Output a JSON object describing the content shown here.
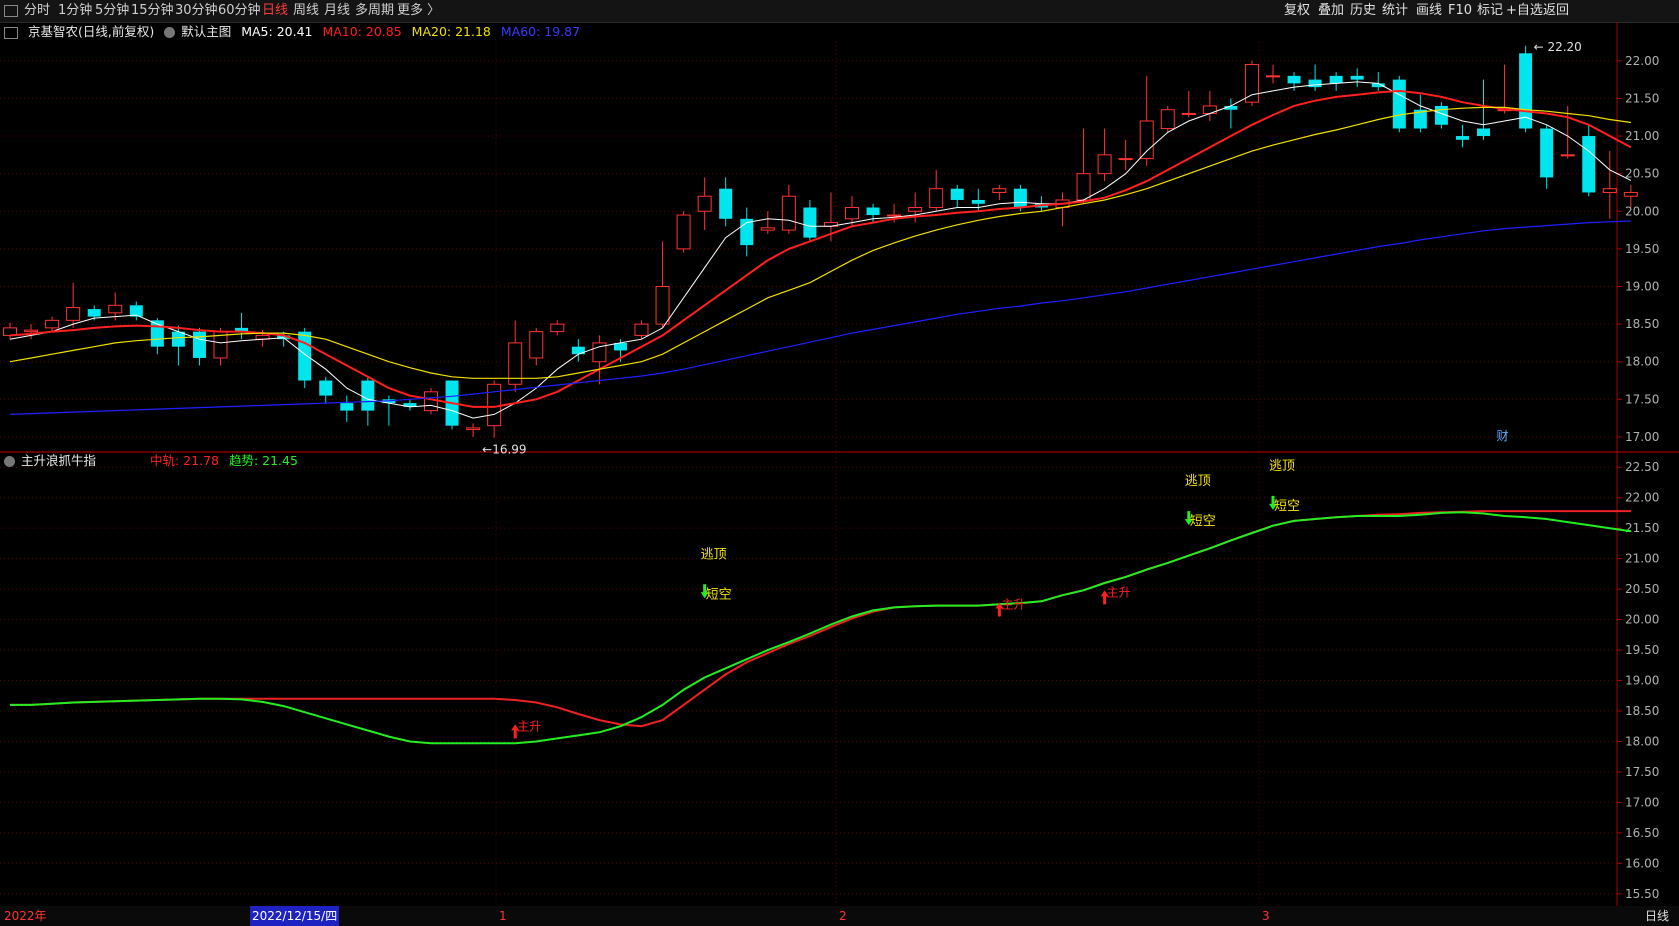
{
  "toolbar": {
    "periods": [
      "分时",
      "1分钟",
      "5分钟",
      "15分钟",
      "30分钟",
      "60分钟",
      "日线",
      "周线",
      "月线",
      "多周期",
      "更多 〉"
    ],
    "active_period": "日线",
    "right_buttons": [
      "复权",
      "叠加",
      "历史",
      "统计",
      "画线",
      "F10",
      "标记",
      "+自选",
      "返回"
    ]
  },
  "stock_info": {
    "name": "京基智农",
    "period_desc": "(日线,前复权)",
    "main_chart_label": "默认主图",
    "ma5": "MA5: 20.41",
    "ma10": "MA10: 20.85",
    "ma20": "MA20: 21.18",
    "ma60": "MA60: 19.87"
  },
  "indicator_info": {
    "name": "主升浪抓牛指",
    "mid": "中轨: 21.78",
    "trend": "趋势: 21.45"
  },
  "colors": {
    "up": "#ff3333",
    "down": "#00e5ee",
    "ma5": "#ffffff",
    "ma10": "#ff2020",
    "ma20": "#f0e000",
    "ma60": "#2020ff",
    "trend": "#22ee22",
    "mid": "#ee2222",
    "grid": "#5a0000",
    "axis_text": "#b0b0b0",
    "label_yellow": "#f5e400"
  },
  "bottom": {
    "year": "2022年",
    "date_cursor": "2022/12/15/四",
    "months": [
      "1",
      "2",
      "3"
    ],
    "period_right": "日线"
  },
  "chart_data": [
    {
      "type": "candlestick",
      "title": "京基智农",
      "ylim": [
        16.8,
        22.25
      ],
      "yticks": [
        "17.00",
        "17.50",
        "18.00",
        "18.50",
        "19.00",
        "19.50",
        "20.00",
        "20.50",
        "21.00",
        "21.50",
        "22.00"
      ],
      "high_label": "22.20",
      "low_label": "16.99",
      "marker": "财",
      "candles": [
        [
          18.35,
          18.45,
          18.3,
          18.52
        ],
        [
          18.4,
          18.42,
          18.3,
          18.5
        ],
        [
          18.45,
          18.55,
          18.4,
          18.6
        ],
        [
          18.55,
          18.72,
          18.45,
          19.05
        ],
        [
          18.7,
          18.6,
          18.55,
          18.75
        ],
        [
          18.65,
          18.75,
          18.55,
          18.92
        ],
        [
          18.75,
          18.6,
          18.55,
          18.8
        ],
        [
          18.55,
          18.2,
          18.1,
          18.58
        ],
        [
          18.4,
          18.2,
          17.95,
          18.48
        ],
        [
          18.4,
          18.05,
          17.95,
          18.45
        ],
        [
          18.05,
          18.4,
          17.95,
          18.45
        ],
        [
          18.45,
          18.4,
          18.3,
          18.65
        ],
        [
          18.3,
          18.35,
          18.2,
          18.42
        ],
        [
          18.35,
          18.3,
          18.2,
          18.4
        ],
        [
          18.4,
          17.75,
          17.65,
          18.45
        ],
        [
          17.75,
          17.55,
          17.45,
          17.8
        ],
        [
          17.45,
          17.35,
          17.2,
          17.55
        ],
        [
          17.75,
          17.35,
          17.15,
          17.8
        ],
        [
          17.5,
          17.45,
          17.15,
          17.55
        ],
        [
          17.45,
          17.4,
          17.35,
          17.5
        ],
        [
          17.35,
          17.6,
          17.3,
          17.65
        ],
        [
          17.75,
          17.15,
          17.1,
          17.75
        ],
        [
          17.1,
          17.12,
          17.0,
          17.18
        ],
        [
          17.15,
          17.7,
          16.99,
          17.75
        ],
        [
          17.7,
          18.25,
          17.6,
          18.55
        ],
        [
          18.05,
          18.4,
          17.95,
          18.45
        ],
        [
          18.4,
          18.5,
          18.35,
          18.55
        ],
        [
          18.2,
          18.1,
          18.0,
          18.3
        ],
        [
          18.0,
          18.25,
          17.7,
          18.35
        ],
        [
          18.25,
          18.15,
          18.0,
          18.3
        ],
        [
          18.35,
          18.5,
          18.3,
          18.55
        ],
        [
          18.5,
          19.0,
          18.45,
          19.6
        ],
        [
          19.5,
          19.95,
          19.45,
          20.0
        ],
        [
          20.0,
          20.2,
          19.75,
          20.45
        ],
        [
          20.3,
          19.9,
          19.8,
          20.45
        ],
        [
          19.9,
          19.55,
          19.4,
          20.05
        ],
        [
          19.75,
          19.78,
          19.7,
          20.0
        ],
        [
          19.75,
          20.2,
          19.7,
          20.35
        ],
        [
          20.05,
          19.65,
          19.6,
          20.15
        ],
        [
          19.8,
          19.85,
          19.6,
          20.25
        ],
        [
          19.9,
          20.05,
          19.8,
          20.2
        ],
        [
          20.05,
          19.95,
          19.85,
          20.1
        ],
        [
          19.95,
          19.95,
          19.85,
          20.1
        ],
        [
          20.0,
          20.05,
          19.85,
          20.25
        ],
        [
          20.05,
          20.3,
          20.0,
          20.55
        ],
        [
          20.3,
          20.15,
          20.05,
          20.35
        ],
        [
          20.15,
          20.1,
          20.0,
          20.3
        ],
        [
          20.25,
          20.3,
          20.15,
          20.35
        ],
        [
          20.3,
          20.05,
          20.0,
          20.35
        ],
        [
          20.1,
          20.05,
          20.0,
          20.2
        ],
        [
          20.05,
          20.15,
          19.8,
          20.25
        ],
        [
          20.15,
          20.5,
          20.1,
          21.1
        ],
        [
          20.5,
          20.75,
          20.4,
          21.1
        ],
        [
          20.7,
          20.7,
          20.55,
          20.95
        ],
        [
          20.7,
          21.2,
          20.6,
          21.8
        ],
        [
          21.1,
          21.35,
          21.05,
          21.4
        ],
        [
          21.3,
          21.3,
          21.25,
          21.6
        ],
        [
          21.3,
          21.4,
          21.2,
          21.6
        ],
        [
          21.4,
          21.35,
          21.1,
          21.5
        ],
        [
          21.45,
          21.95,
          21.4,
          22.0
        ],
        [
          21.8,
          21.8,
          21.7,
          21.95
        ],
        [
          21.8,
          21.7,
          21.6,
          21.85
        ],
        [
          21.75,
          21.65,
          21.6,
          21.95
        ],
        [
          21.8,
          21.7,
          21.6,
          21.85
        ],
        [
          21.8,
          21.75,
          21.65,
          21.9
        ],
        [
          21.7,
          21.65,
          21.6,
          21.85
        ],
        [
          21.75,
          21.1,
          21.05,
          21.8
        ],
        [
          21.35,
          21.1,
          21.05,
          21.55
        ],
        [
          21.4,
          21.15,
          21.1,
          21.45
        ],
        [
          21.0,
          20.95,
          20.85,
          21.15
        ],
        [
          21.1,
          21.0,
          20.95,
          21.75
        ],
        [
          21.35,
          21.35,
          21.3,
          21.95
        ],
        [
          22.1,
          21.1,
          21.05,
          22.2
        ],
        [
          21.1,
          20.45,
          20.3,
          21.15
        ],
        [
          20.75,
          20.75,
          20.7,
          21.4
        ],
        [
          21.0,
          20.25,
          20.2,
          21.15
        ],
        [
          20.25,
          20.3,
          19.9,
          20.8
        ],
        [
          20.2,
          20.25,
          20.05,
          20.35
        ]
      ],
      "series": [
        {
          "name": "MA5",
          "values": [
            18.3,
            18.35,
            18.4,
            18.5,
            18.58,
            18.6,
            18.62,
            18.5,
            18.4,
            18.3,
            18.25,
            18.28,
            18.3,
            18.32,
            18.1,
            17.9,
            17.65,
            17.5,
            17.45,
            17.4,
            17.42,
            17.35,
            17.25,
            17.3,
            17.45,
            17.65,
            17.9,
            18.1,
            18.2,
            18.25,
            18.3,
            18.45,
            18.85,
            19.25,
            19.65,
            19.85,
            19.9,
            19.88,
            19.8,
            19.8,
            19.85,
            19.9,
            19.92,
            19.95,
            20.0,
            20.05,
            20.05,
            20.1,
            20.12,
            20.1,
            20.1,
            20.15,
            20.3,
            20.5,
            20.8,
            21.05,
            21.2,
            21.3,
            21.4,
            21.55,
            21.6,
            21.65,
            21.68,
            21.7,
            21.72,
            21.7,
            21.55,
            21.4,
            21.3,
            21.2,
            21.15,
            21.2,
            21.25,
            21.15,
            21.0,
            20.8,
            20.55,
            20.41
          ]
        },
        {
          "name": "MA10",
          "values": [
            18.35,
            18.37,
            18.4,
            18.42,
            18.45,
            18.47,
            18.48,
            18.47,
            18.45,
            18.42,
            18.4,
            18.4,
            18.38,
            18.35,
            18.25,
            18.1,
            17.95,
            17.8,
            17.65,
            17.55,
            17.5,
            17.45,
            17.4,
            17.4,
            17.45,
            17.5,
            17.6,
            17.75,
            17.9,
            18.05,
            18.2,
            18.35,
            18.55,
            18.75,
            18.95,
            19.15,
            19.35,
            19.5,
            19.6,
            19.7,
            19.8,
            19.85,
            19.9,
            19.93,
            19.95,
            19.98,
            20.0,
            20.03,
            20.05,
            20.08,
            20.1,
            20.13,
            20.18,
            20.28,
            20.4,
            20.55,
            20.7,
            20.85,
            21.0,
            21.15,
            21.28,
            21.4,
            21.47,
            21.52,
            21.55,
            21.58,
            21.6,
            21.57,
            21.52,
            21.45,
            21.4,
            21.36,
            21.33,
            21.3,
            21.25,
            21.15,
            21.0,
            20.85
          ]
        },
        {
          "name": "MA20",
          "values": [
            18.0,
            18.05,
            18.1,
            18.15,
            18.2,
            18.25,
            18.28,
            18.3,
            18.32,
            18.33,
            18.35,
            18.37,
            18.38,
            18.38,
            18.35,
            18.3,
            18.2,
            18.1,
            18.0,
            17.92,
            17.85,
            17.8,
            17.78,
            17.78,
            17.78,
            17.78,
            17.8,
            17.85,
            17.9,
            17.95,
            18.0,
            18.1,
            18.25,
            18.4,
            18.55,
            18.7,
            18.85,
            18.95,
            19.05,
            19.2,
            19.35,
            19.48,
            19.58,
            19.67,
            19.75,
            19.82,
            19.88,
            19.93,
            19.97,
            20.0,
            20.05,
            20.1,
            20.15,
            20.22,
            20.3,
            20.4,
            20.5,
            20.6,
            20.7,
            20.8,
            20.88,
            20.95,
            21.02,
            21.08,
            21.15,
            21.22,
            21.28,
            21.32,
            21.35,
            21.37,
            21.38,
            21.38,
            21.35,
            21.33,
            21.3,
            21.27,
            21.22,
            21.18
          ]
        },
        {
          "name": "MA60",
          "values": [
            17.3,
            17.31,
            17.32,
            17.33,
            17.34,
            17.35,
            17.36,
            17.37,
            17.38,
            17.39,
            17.4,
            17.41,
            17.42,
            17.43,
            17.44,
            17.45,
            17.46,
            17.47,
            17.48,
            17.5,
            17.52,
            17.54,
            17.57,
            17.6,
            17.63,
            17.66,
            17.69,
            17.72,
            17.75,
            17.78,
            17.81,
            17.85,
            17.9,
            17.96,
            18.02,
            18.08,
            18.14,
            18.2,
            18.26,
            18.32,
            18.38,
            18.43,
            18.48,
            18.53,
            18.58,
            18.63,
            18.67,
            18.71,
            18.74,
            18.78,
            18.81,
            18.85,
            18.89,
            18.93,
            18.98,
            19.03,
            19.08,
            19.13,
            19.18,
            19.23,
            19.28,
            19.33,
            19.38,
            19.43,
            19.48,
            19.53,
            19.57,
            19.62,
            19.66,
            19.7,
            19.74,
            19.77,
            19.79,
            19.81,
            19.83,
            19.85,
            19.86,
            19.87
          ]
        }
      ]
    },
    {
      "type": "line",
      "title": "主升浪抓牛指",
      "ylim": [
        15.3,
        22.75
      ],
      "yticks": [
        "15.50",
        "16.00",
        "16.50",
        "17.00",
        "17.50",
        "18.00",
        "18.50",
        "19.00",
        "19.50",
        "20.00",
        "20.50",
        "21.00",
        "21.50",
        "22.00",
        "22.50"
      ],
      "series": [
        {
          "name": "中轨",
          "values": [
            18.6,
            18.6,
            18.62,
            18.64,
            18.65,
            18.66,
            18.67,
            18.68,
            18.69,
            18.7,
            18.7,
            18.7,
            18.7,
            18.7,
            18.7,
            18.7,
            18.7,
            18.7,
            18.7,
            18.7,
            18.7,
            18.7,
            18.7,
            18.7,
            18.68,
            18.64,
            18.56,
            18.45,
            18.35,
            18.28,
            18.25,
            18.35,
            18.6,
            18.85,
            19.1,
            19.3,
            19.45,
            19.6,
            19.73,
            19.88,
            20.02,
            20.13,
            20.2,
            20.22,
            20.23,
            20.23,
            20.23,
            20.25,
            20.27,
            20.3,
            20.4,
            20.48,
            20.6,
            20.7,
            20.82,
            20.93,
            21.05,
            21.17,
            21.3,
            21.42,
            21.54,
            21.62,
            21.65,
            21.68,
            21.7,
            21.72,
            21.73,
            21.75,
            21.76,
            21.77,
            21.78,
            21.78,
            21.78,
            21.78,
            21.78,
            21.78,
            21.78,
            21.78
          ]
        },
        {
          "name": "趋势",
          "values": [
            18.6,
            18.6,
            18.62,
            18.64,
            18.65,
            18.66,
            18.67,
            18.68,
            18.69,
            18.7,
            18.7,
            18.69,
            18.65,
            18.58,
            18.48,
            18.38,
            18.28,
            18.18,
            18.08,
            18.0,
            17.97,
            17.97,
            17.97,
            17.97,
            17.97,
            18.0,
            18.05,
            18.1,
            18.15,
            18.25,
            18.4,
            18.6,
            18.85,
            19.05,
            19.2,
            19.35,
            19.5,
            19.63,
            19.77,
            19.92,
            20.05,
            20.15,
            20.2,
            20.22,
            20.23,
            20.23,
            20.23,
            20.25,
            20.27,
            20.3,
            20.4,
            20.48,
            20.6,
            20.7,
            20.82,
            20.93,
            21.05,
            21.17,
            21.3,
            21.42,
            21.54,
            21.62,
            21.65,
            21.68,
            21.7,
            21.7,
            21.7,
            21.72,
            21.75,
            21.76,
            21.74,
            21.7,
            21.68,
            21.65,
            21.6,
            21.55,
            21.5,
            21.45
          ]
        }
      ],
      "annotations": [
        {
          "index": 24,
          "value": 18.05,
          "text": "主升",
          "kind": "up"
        },
        {
          "index": 33,
          "value": 20.35,
          "text": "逃顶",
          "kind": "top"
        },
        {
          "index": 33,
          "value": 20.35,
          "text": "短空",
          "kind": "down"
        },
        {
          "index": 47,
          "value": 20.05,
          "text": "主升",
          "kind": "up"
        },
        {
          "index": 52,
          "value": 20.25,
          "text": "主升",
          "kind": "up"
        },
        {
          "index": 56,
          "value": 21.55,
          "text": "逃顶",
          "kind": "top"
        },
        {
          "index": 56,
          "value": 21.55,
          "text": "短空",
          "kind": "down"
        },
        {
          "index": 60,
          "value": 21.8,
          "text": "逃顶",
          "kind": "top"
        },
        {
          "index": 60,
          "value": 21.8,
          "text": "短空",
          "kind": "down"
        }
      ]
    }
  ]
}
